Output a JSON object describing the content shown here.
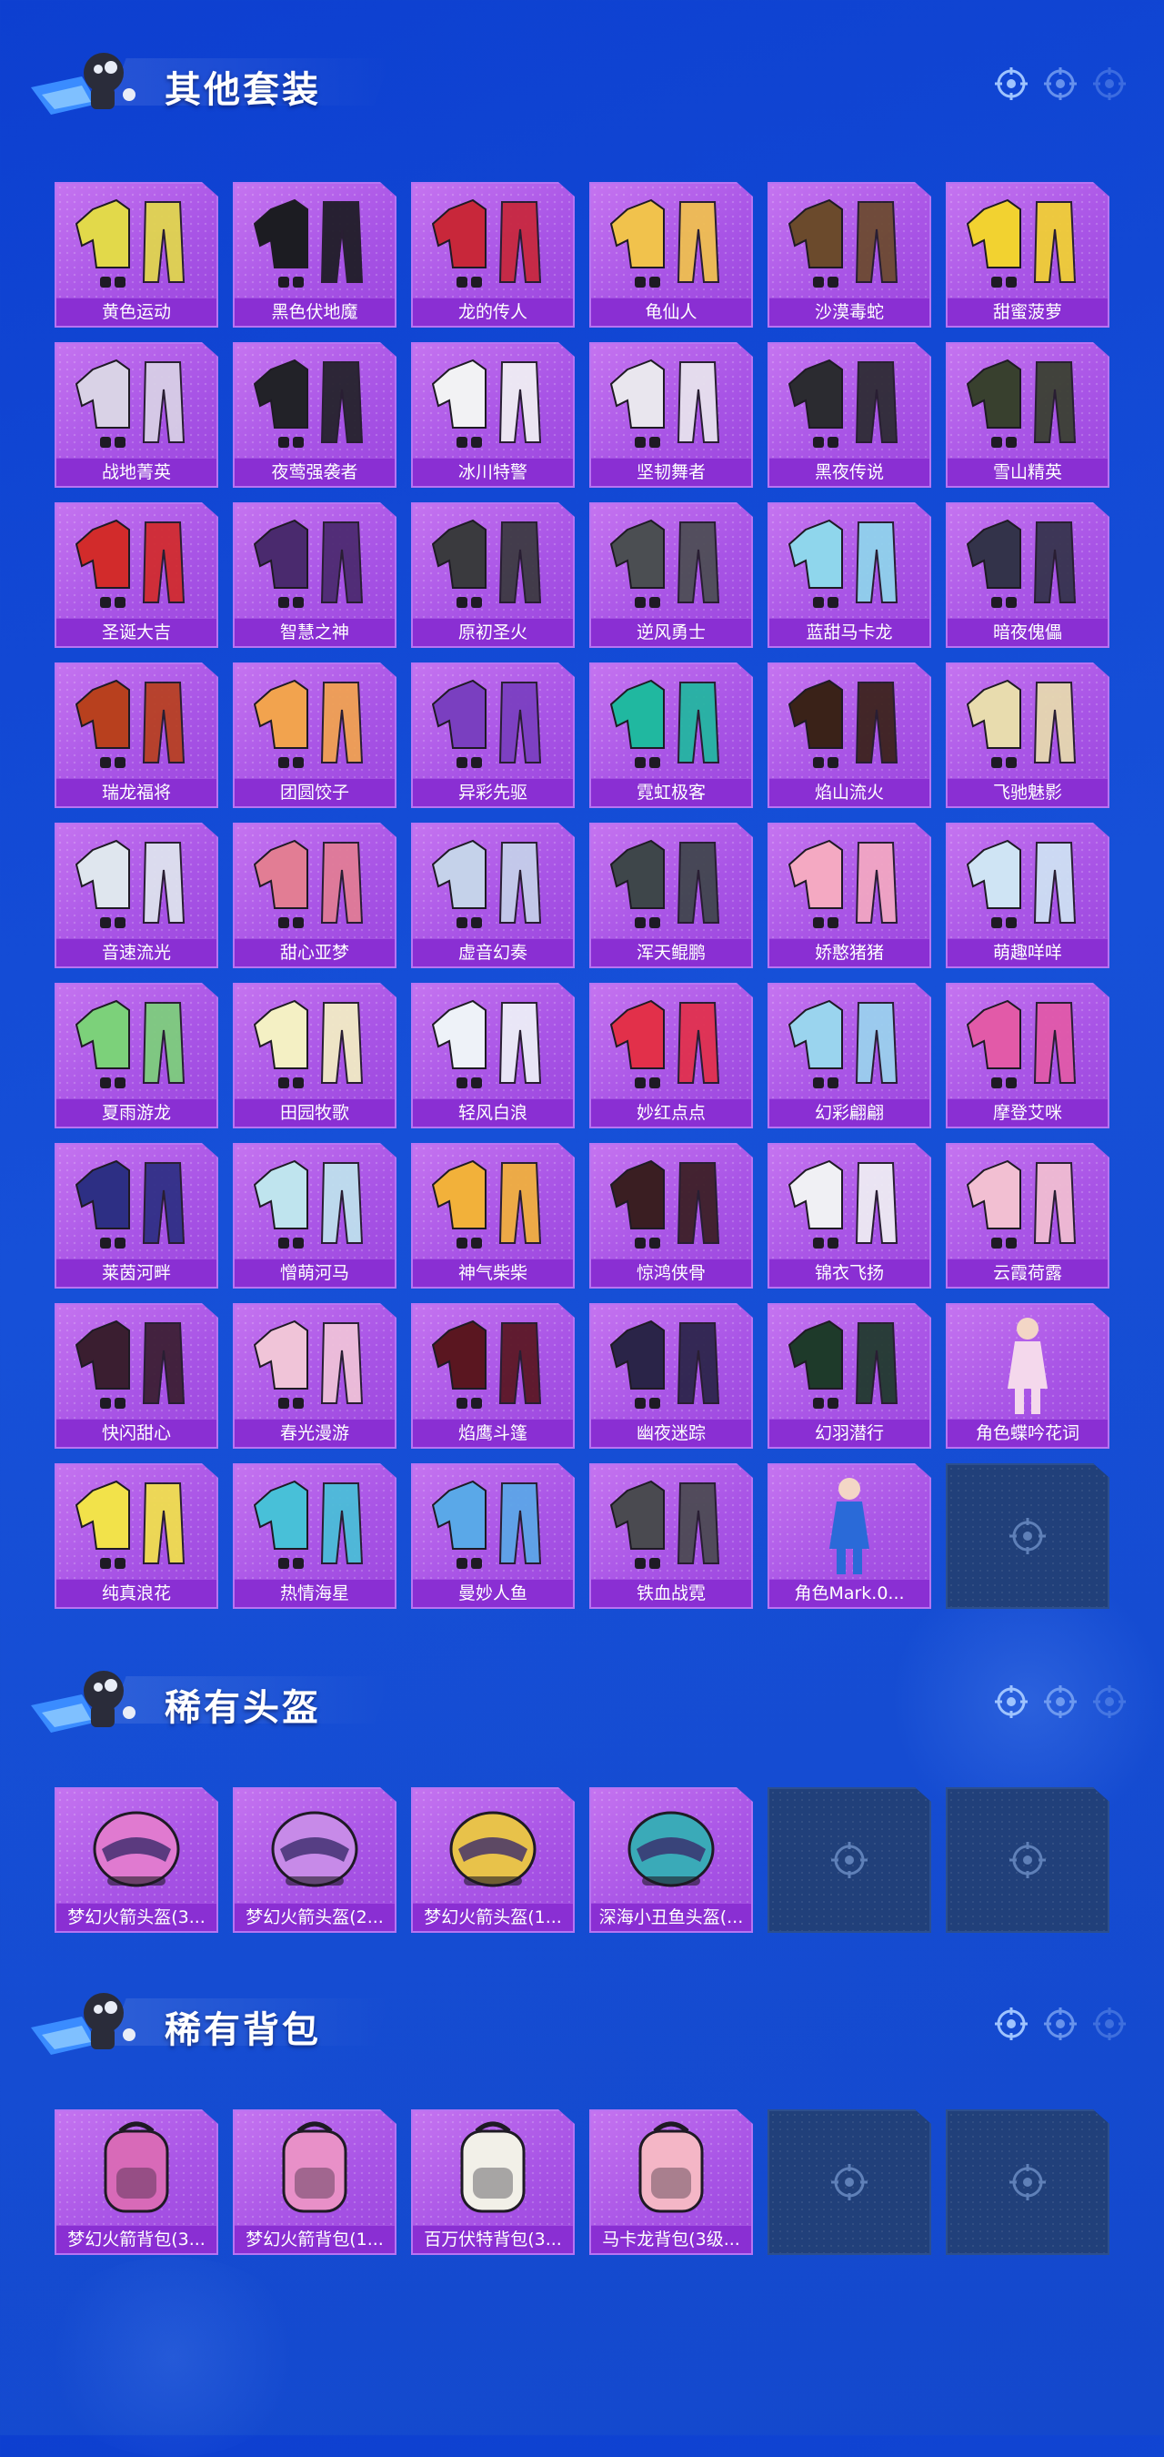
{
  "theme": {
    "accent": "#8a2fd3",
    "tile": "#b56be9",
    "empty_tile": "#21407a",
    "background": "#1650d8"
  },
  "sections": [
    {
      "title": "其他套装",
      "items": [
        {
          "label": "黄色运动",
          "icon": "outfit-icon",
          "color": "#e2d94a"
        },
        {
          "label": "黑色伏地魔",
          "icon": "outfit-icon",
          "color": "#1c1c22"
        },
        {
          "label": "龙的传人",
          "icon": "outfit-icon",
          "color": "#c8273a"
        },
        {
          "label": "龟仙人",
          "icon": "outfit-icon",
          "color": "#f1c24c"
        },
        {
          "label": "沙漠毒蛇",
          "icon": "outfit-icon",
          "color": "#6b4a2c"
        },
        {
          "label": "甜蜜菠萝",
          "icon": "outfit-icon",
          "color": "#f2d230"
        },
        {
          "label": "战地菁英",
          "icon": "outfit-icon",
          "color": "#d9d2e6"
        },
        {
          "label": "夜莺强袭者",
          "icon": "outfit-icon",
          "color": "#222228"
        },
        {
          "label": "冰川特警",
          "icon": "outfit-icon",
          "color": "#f2f2f4"
        },
        {
          "label": "坚韧舞者",
          "icon": "outfit-icon",
          "color": "#e9e6ee"
        },
        {
          "label": "黑夜传说",
          "icon": "outfit-icon",
          "color": "#2b2b30"
        },
        {
          "label": "雪山精英",
          "icon": "outfit-icon",
          "color": "#38402e"
        },
        {
          "label": "圣诞大吉",
          "icon": "outfit-icon",
          "color": "#d22b2b"
        },
        {
          "label": "智慧之神",
          "icon": "outfit-icon",
          "color": "#4a2a6e"
        },
        {
          "label": "原初圣火",
          "icon": "outfit-icon",
          "color": "#3a3a3e"
        },
        {
          "label": "逆风勇士",
          "icon": "outfit-icon",
          "color": "#4b4e52"
        },
        {
          "label": "蓝甜马卡龙",
          "icon": "outfit-icon",
          "color": "#8fd6ec"
        },
        {
          "label": "暗夜傀儡",
          "icon": "outfit-icon",
          "color": "#33334a"
        },
        {
          "label": "瑞龙福将",
          "icon": "outfit-icon",
          "color": "#b8401e"
        },
        {
          "label": "团圆饺子",
          "icon": "outfit-icon",
          "color": "#f2a34e"
        },
        {
          "label": "异彩先驱",
          "icon": "outfit-icon",
          "color": "#7a3fc0"
        },
        {
          "label": "霓虹极客",
          "icon": "outfit-icon",
          "color": "#20b8a0"
        },
        {
          "label": "焰山流火",
          "icon": "outfit-icon",
          "color": "#3a2218"
        },
        {
          "label": "飞驰魅影",
          "icon": "outfit-icon",
          "color": "#e8dcae"
        },
        {
          "label": "音速流光",
          "icon": "outfit-icon",
          "color": "#dfe6ee"
        },
        {
          "label": "甜心亚梦",
          "icon": "outfit-icon",
          "color": "#e27d94"
        },
        {
          "label": "虚音幻奏",
          "icon": "outfit-icon",
          "color": "#c5d2ea"
        },
        {
          "label": "浑天鲲鹏",
          "icon": "outfit-icon",
          "color": "#3e464a"
        },
        {
          "label": "娇憨猪猪",
          "icon": "outfit-icon",
          "color": "#f4a9c2"
        },
        {
          "label": "萌趣咩咩",
          "icon": "outfit-icon",
          "color": "#cfe4f4"
        },
        {
          "label": "夏雨游龙",
          "icon": "outfit-icon",
          "color": "#7cd17a"
        },
        {
          "label": "田园牧歌",
          "icon": "outfit-icon",
          "color": "#f4f0c4"
        },
        {
          "label": "轻风白浪",
          "icon": "outfit-icon",
          "color": "#eef2f8"
        },
        {
          "label": "妙红点点",
          "icon": "outfit-icon",
          "color": "#e2304a"
        },
        {
          "label": "幻彩翩翩",
          "icon": "outfit-icon",
          "color": "#9ad4ee"
        },
        {
          "label": "摩登艾咪",
          "icon": "outfit-icon",
          "color": "#e25aa8"
        },
        {
          "label": "莱茵河畔",
          "icon": "outfit-icon",
          "color": "#2d2f84"
        },
        {
          "label": "憎萌河马",
          "icon": "outfit-icon",
          "color": "#bfe4ee"
        },
        {
          "label": "神气柴柴",
          "icon": "outfit-icon",
          "color": "#f2b13a"
        },
        {
          "label": "惊鸿侠骨",
          "icon": "outfit-icon",
          "color": "#3a1e22"
        },
        {
          "label": "锦衣飞扬",
          "icon": "outfit-icon",
          "color": "#f0f0f4"
        },
        {
          "label": "云霞荷露",
          "icon": "outfit-icon",
          "color": "#f2bfd2"
        },
        {
          "label": "快闪甜心",
          "icon": "outfit-icon",
          "color": "#3a1e30"
        },
        {
          "label": "春光漫游",
          "icon": "outfit-icon",
          "color": "#f0c4d8"
        },
        {
          "label": "焰鹰斗篷",
          "icon": "outfit-icon",
          "color": "#5a1620"
        },
        {
          "label": "幽夜迷踪",
          "icon": "outfit-icon",
          "color": "#2a2448"
        },
        {
          "label": "幻羽潜行",
          "icon": "outfit-icon",
          "color": "#1e3a2a"
        },
        {
          "label": "角色蝶吟花词",
          "icon": "character-icon",
          "color": "#f4d8ec"
        },
        {
          "label": "纯真浪花",
          "icon": "outfit-icon",
          "color": "#f2e24a"
        },
        {
          "label": "热情海星",
          "icon": "outfit-icon",
          "color": "#48c0d8"
        },
        {
          "label": "曼妙人鱼",
          "icon": "outfit-icon",
          "color": "#5aa8e8"
        },
        {
          "label": "铁血战霓",
          "icon": "outfit-icon",
          "color": "#4a4a50"
        },
        {
          "label": "角色Mark.0...",
          "icon": "character-icon",
          "color": "#2a6ad8"
        },
        {
          "label": "",
          "icon": "empty-slot-icon",
          "empty": true
        }
      ]
    },
    {
      "title": "稀有头盔",
      "items": [
        {
          "label": "梦幻火箭头盔(3...",
          "icon": "helmet-icon",
          "color": "#e07ad0"
        },
        {
          "label": "梦幻火箭头盔(2...",
          "icon": "helmet-icon",
          "color": "#c78ae8"
        },
        {
          "label": "梦幻火箭头盔(1...",
          "icon": "helmet-icon",
          "color": "#e8c24a"
        },
        {
          "label": "深海小丑鱼头盔(...",
          "icon": "helmet-icon",
          "color": "#3aaab8"
        },
        {
          "label": "",
          "icon": "empty-slot-icon",
          "empty": true
        },
        {
          "label": "",
          "icon": "empty-slot-icon",
          "empty": true
        }
      ]
    },
    {
      "title": "稀有背包",
      "items": [
        {
          "label": "梦幻火箭背包(3...",
          "icon": "backpack-icon",
          "color": "#d86ab8"
        },
        {
          "label": "梦幻火箭背包(1...",
          "icon": "backpack-icon",
          "color": "#e890c8"
        },
        {
          "label": "百万伏特背包(3...",
          "icon": "backpack-icon",
          "color": "#f2f0e8"
        },
        {
          "label": "马卡龙背包(3级...",
          "icon": "backpack-icon",
          "color": "#f4b6c6"
        },
        {
          "label": "",
          "icon": "empty-slot-icon",
          "empty": true
        },
        {
          "label": "",
          "icon": "empty-slot-icon",
          "empty": true
        }
      ]
    }
  ]
}
